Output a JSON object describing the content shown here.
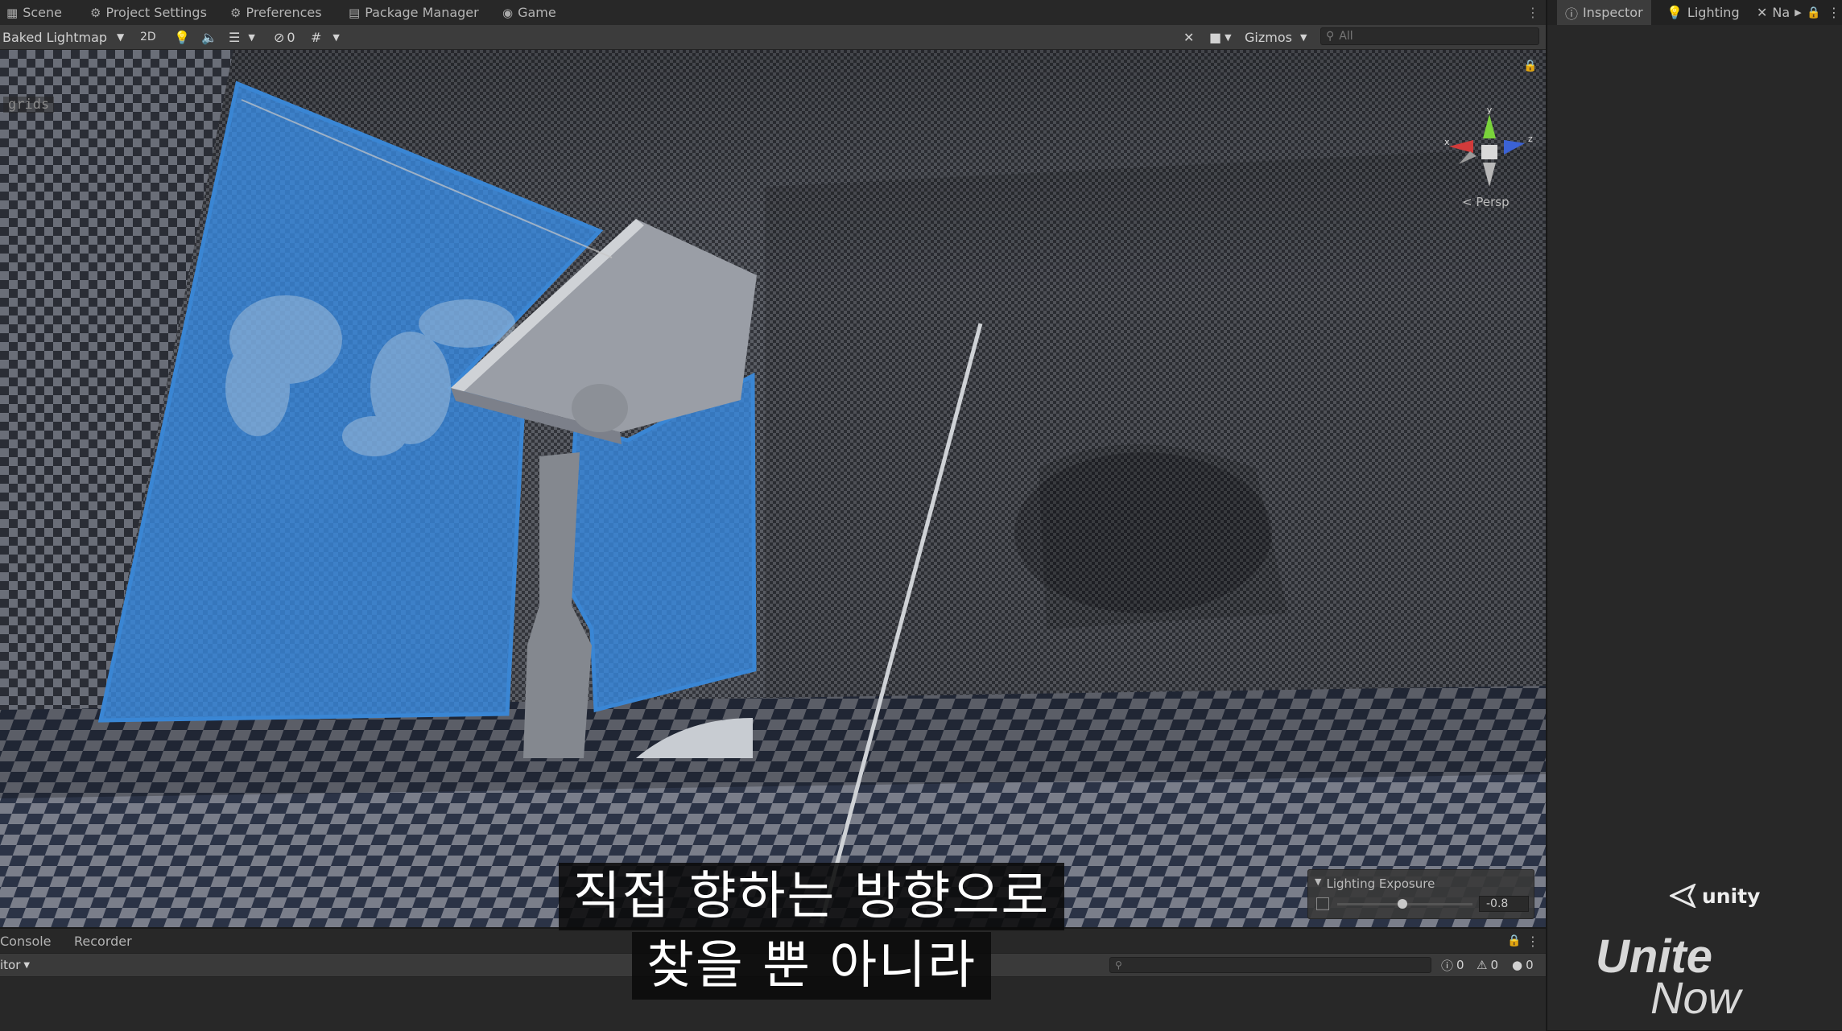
{
  "editor_tabs": [
    {
      "label": "Scene",
      "icon": "scene-grid-icon"
    },
    {
      "label": "Project Settings",
      "icon": "gear-icon"
    },
    {
      "label": "Preferences",
      "icon": "gear-icon"
    },
    {
      "label": "Package Manager",
      "icon": "package-icon"
    },
    {
      "label": "Game",
      "icon": "gamepad-icon"
    }
  ],
  "scene_toolbar": {
    "draw_mode": "Baked Lightmap",
    "mode_2d": "2D",
    "hidden_count": "0",
    "gizmos_label": "Gizmos",
    "search_placeholder": "All"
  },
  "viewport": {
    "overlay_label": "grids",
    "camera_mode": "Persp",
    "gizmo_axes": {
      "x": "x",
      "y": "y",
      "z": "z"
    },
    "selection_color": "#3a86d4"
  },
  "lighting_exposure": {
    "title": "Lighting Exposure",
    "value": "-0.8",
    "slider_fraction": 0.48
  },
  "console": {
    "tabs": [
      "Console",
      "Recorder"
    ],
    "editor_dropdown": "itor",
    "error_count": "0",
    "warning_count": "0",
    "log_count": "0"
  },
  "right_panel": {
    "tabs": [
      {
        "label": "Inspector",
        "icon": "info-icon"
      },
      {
        "label": "Lighting",
        "icon": "lightbulb-icon"
      },
      {
        "label": "Na",
        "icon": "navigation-icon"
      }
    ]
  },
  "branding": {
    "unity_label": "unity",
    "unite_label": "Unite",
    "now_label": "Now"
  },
  "subtitles": {
    "line1": "직접 향하는 방향으로",
    "line2": "찾을 뿐 아니라"
  }
}
